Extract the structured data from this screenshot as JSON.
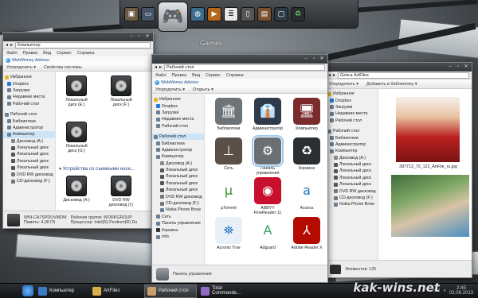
{
  "dock": {
    "label": "Games",
    "icons": [
      "photo-frame-icon",
      "monitor-icon",
      "gamepad-icon",
      "globe-icon",
      "media-player-icon",
      "document-icon",
      "phone-icon",
      "wood-device-icon",
      "screen-icon",
      "recycle-bin-icon"
    ]
  },
  "left_window": {
    "address": "Компьютер",
    "menu": [
      "Файл",
      "Правка",
      "Вид",
      "Сервис",
      "Справка"
    ],
    "brand": "WebMoney Advisor",
    "toolbar": [
      "Упорядочить ▾",
      "Свойства системы"
    ],
    "nav": [
      {
        "label": "Избранное",
        "kind": "head"
      },
      {
        "label": "Dropbox",
        "kind": "sub"
      },
      {
        "label": "Загрузки",
        "kind": "sub"
      },
      {
        "label": "Недавние места",
        "kind": "sub"
      },
      {
        "label": "Рабочий стол",
        "kind": "sub"
      },
      {
        "label": "",
        "kind": "gap"
      },
      {
        "label": "Рабочий стол",
        "kind": "head"
      },
      {
        "label": "Библиотеки",
        "kind": "sub"
      },
      {
        "label": "Администратор",
        "kind": "sub"
      },
      {
        "label": "Компьютер",
        "kind": "sub",
        "selected": true
      },
      {
        "label": "Дисковод (A:)",
        "kind": "sub2"
      },
      {
        "label": "Локальный диск",
        "kind": "sub2"
      },
      {
        "label": "Локальный диск",
        "kind": "sub2"
      },
      {
        "label": "Локальный диск",
        "kind": "sub2"
      },
      {
        "label": "Локальный диск",
        "kind": "sub2"
      },
      {
        "label": "DVD RW дисковод",
        "kind": "sub2"
      },
      {
        "label": "CD-дисковод (F:)",
        "kind": "sub2"
      }
    ],
    "drives": [
      {
        "label": "Локальный диск (E:)"
      },
      {
        "label": "Локальный диск (F:)"
      },
      {
        "label": "Локальный диск (G:)"
      }
    ],
    "removable_group": "Устройства со съемными носи...",
    "removable": [
      {
        "label": "Дисковод (A:)"
      },
      {
        "label": "DVD RW дисковод (I:)"
      }
    ],
    "status": {
      "computer_name": "WIN-CA7SPDUVMOM",
      "workgroup_label": "Рабочая группа:",
      "workgroup": "WORKGROUP",
      "cpu_label": "Процессор:",
      "cpu": "Intel(R) Pentium(R) Du",
      "memory_label": "Память:",
      "memory": "4,00 ГБ"
    }
  },
  "center_window": {
    "address": "Рабочий стол",
    "menu": [
      "Файл",
      "Правка",
      "Вид",
      "Сервис",
      "Справка"
    ],
    "brand": "WebMoney Advisor",
    "toolbar": [
      "Упорядочить ▾",
      "Открыть ▾"
    ],
    "nav": [
      {
        "label": "Избранное",
        "kind": "head"
      },
      {
        "label": "Dropbox",
        "kind": "sub"
      },
      {
        "label": "Загрузки",
        "kind": "sub"
      },
      {
        "label": "Недавние места",
        "kind": "sub"
      },
      {
        "label": "Рабочий стол",
        "kind": "sub"
      },
      {
        "label": "",
        "kind": "gap"
      },
      {
        "label": "Рабочий стол",
        "kind": "head",
        "selected": true
      },
      {
        "label": "Библиотеки",
        "kind": "sub"
      },
      {
        "label": "Администратор",
        "kind": "sub"
      },
      {
        "label": "Компьютер",
        "kind": "sub"
      },
      {
        "label": "Дисковод (A:)",
        "kind": "sub2"
      },
      {
        "label": "Локальный диск",
        "kind": "sub2"
      },
      {
        "label": "Локальный диск",
        "kind": "sub2"
      },
      {
        "label": "Локальный диск",
        "kind": "sub2"
      },
      {
        "label": "Локальный диск",
        "kind": "sub2"
      },
      {
        "label": "DVD RW дисковод",
        "kind": "sub2"
      },
      {
        "label": "CD-дисковод (F:)",
        "kind": "sub2"
      },
      {
        "label": "Nokia Phone Brow",
        "kind": "sub2"
      },
      {
        "label": "Сеть",
        "kind": "sub"
      },
      {
        "label": "Панель управления",
        "kind": "sub"
      },
      {
        "label": "Корзина",
        "kind": "sub"
      },
      {
        "label": "Info",
        "kind": "sub"
      }
    ],
    "icons": [
      {
        "label": "Библиотеки",
        "icon": "library-icon",
        "glyph": "🏛",
        "color": "#6e7377"
      },
      {
        "label": "Администратор",
        "icon": "user-suit-icon",
        "glyph": "👔",
        "color": "#2f3a4a"
      },
      {
        "label": "Компьютер",
        "icon": "computer-icon",
        "glyph": "🖥",
        "color": "#7a2b2b"
      },
      {
        "label": "Сеть",
        "icon": "network-icon",
        "glyph": "⊥",
        "color": "#5a5047"
      },
      {
        "label": "Панель управления",
        "icon": "control-panel-gear-icon",
        "glyph": "⚙",
        "color": "#6a6f74",
        "selected": true
      },
      {
        "label": "Корзина",
        "icon": "recycle-bin-icon",
        "glyph": "♻",
        "color": "#2c2f31"
      },
      {
        "label": "µTorrent",
        "icon": "utorrent-icon",
        "glyph": "µ",
        "color": "#ffffff",
        "fg": "#3a8e2b"
      },
      {
        "label": "ABBYY FineReader 11",
        "icon": "finereader-icon",
        "glyph": "◉",
        "color": "#c8102e"
      },
      {
        "label": "Access",
        "icon": "access-icon",
        "glyph": "a",
        "color": "#ffffff",
        "fg": "#1e73be"
      },
      {
        "label": "Acronis True",
        "icon": "acronis-icon",
        "glyph": "⛯",
        "color": "#e9f1f8",
        "fg": "#1e73be"
      },
      {
        "label": "Adguard",
        "icon": "adguard-shield-icon",
        "glyph": "A",
        "color": "#ffffff",
        "fg": "#3aa35f"
      },
      {
        "label": "Adobe Reader X",
        "icon": "adobe-reader-icon",
        "glyph": "⅄",
        "color": "#b30b00"
      }
    ],
    "status": "Панель управления"
  },
  "right_window": {
    "address": "Gets ▸ ArtFiles",
    "toolbar": [
      "Упорядочить ▾",
      "Добавить в библиотеку ▾"
    ],
    "nav": [
      {
        "label": "Избранное",
        "kind": "head"
      },
      {
        "label": "Dropbox",
        "kind": "sub"
      },
      {
        "label": "Загрузки",
        "kind": "sub"
      },
      {
        "label": "Недавние места",
        "kind": "sub"
      },
      {
        "label": "Рабочий стол",
        "kind": "sub"
      },
      {
        "label": "",
        "kind": "gap"
      },
      {
        "label": "Рабочий стол",
        "kind": "head"
      },
      {
        "label": "Библиотеки",
        "kind": "sub"
      },
      {
        "label": "Администратор",
        "kind": "sub"
      },
      {
        "label": "Компьютер",
        "kind": "sub"
      },
      {
        "label": "Дисковод (A:)",
        "kind": "sub2"
      },
      {
        "label": "Локальный диск",
        "kind": "sub2"
      },
      {
        "label": "Локальный диск",
        "kind": "sub2"
      },
      {
        "label": "Локальный диск",
        "kind": "sub2"
      },
      {
        "label": "Локальный диск",
        "kind": "sub2"
      },
      {
        "label": "DVD RW дисковод",
        "kind": "sub2"
      },
      {
        "label": "CD-дисковод (F:)",
        "kind": "sub2"
      },
      {
        "label": "Nokia Phone Brow",
        "kind": "sub2"
      }
    ],
    "file1": "397713_70_122_ArtFile_ru.jpg",
    "status": "Элементов: 125"
  },
  "taskbar": {
    "tasks": [
      {
        "label": "Компьютер",
        "color": "#3c7bc9"
      },
      {
        "label": "ArtFiles",
        "color": "#d9b14a"
      },
      {
        "label": "Рабочий стол",
        "color": "#c8a16a",
        "active": true
      },
      {
        "label": "Total Commande...",
        "color": "#8f6bc4"
      }
    ],
    "lang": "EN",
    "time": "2:45",
    "date": "02.08.2013"
  },
  "watermark": "kak-wins.net"
}
